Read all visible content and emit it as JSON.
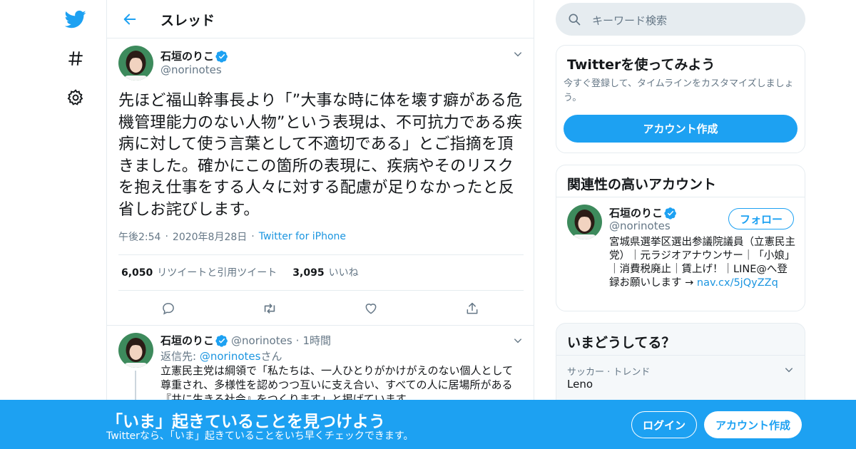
{
  "colors": {
    "accent": "#1da1f2",
    "link": "#1b95e0",
    "muted": "#657786",
    "border": "#e6ecf0",
    "text": "#14171a"
  },
  "nav": {
    "icons": [
      "twitter-bird-icon",
      "hashtag-icon",
      "gear-icon"
    ]
  },
  "header": {
    "title": "スレッド"
  },
  "main_tweet": {
    "name": "石垣のりこ",
    "handle": "@norinotes",
    "text": "先ほど福山幹事長より「”大事な時に体を壊す癖がある危機管理能力のない人物”という表現は、不可抗力である疾病に対して使う言葉として不適切である」とご指摘を頂きました。確かにこの箇所の表現に、疾病やそのリスクを抱え仕事をする人々に対する配慮が足りなかったと反省しお詫びします。",
    "time": "午後2:54",
    "date": "2020年8月28日",
    "source": "Twitter for iPhone",
    "retweets": "6,050",
    "retweets_label": "リツイートと引用ツイート",
    "likes": "3,095",
    "likes_label": "いいね"
  },
  "reply_tweet": {
    "name": "石垣のりこ",
    "handle": "@norinotes",
    "time_ago": "1時間",
    "reply_prefix": "返信先: ",
    "reply_to": "@norinotes",
    "reply_suffix": "さん",
    "text": "立憲民主党は綱領で「私たちは、一人ひとりがかけがえのない個人として尊重され、多様性を認めつつ互いに支え合い、すべての人に居場所がある『共に生きる社会』をつくります」と掲げています。"
  },
  "search": {
    "placeholder": "キーワード検索"
  },
  "signup_card": {
    "title": "Twitterを使ってみよう",
    "text": "今すぐ登録して、タイムラインをカスタマイズしましょう。",
    "button": "アカウント作成"
  },
  "related_card": {
    "title": "関連性の高いアカウント",
    "name": "石垣のりこ",
    "handle": "@norinotes",
    "follow": "フォロー",
    "bio": "宮城県選挙区選出参議院議員（立憲民主党）｜元ラジオアナウンサー｜「小娘」｜消費税廃止｜賃上げ！｜LINE@へ登録お願いします →",
    "link": "nav.cx/5jQyZZq"
  },
  "trends_card": {
    "title": "いまどうしてる？",
    "trend_category": "サッカー · トレンド",
    "trend_name": "Leno"
  },
  "bottom_bar": {
    "title": "「いま」起きていることを見つけよう",
    "subtitle": "Twitterなら、「いま」起きていることをいち早くチェックできます。",
    "login": "ログイン",
    "signup": "アカウント作成"
  }
}
